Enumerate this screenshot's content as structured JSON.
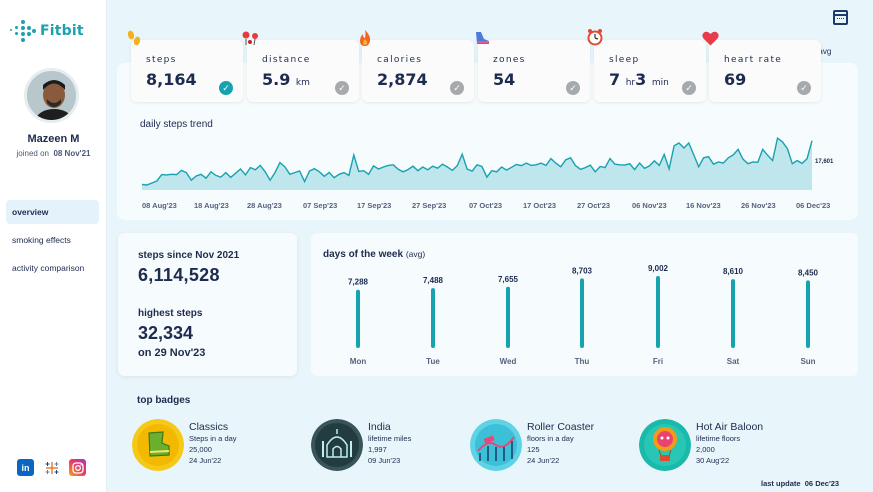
{
  "brand": {
    "name": "Fitbit",
    "accent": "#17a2b0"
  },
  "profile": {
    "name": "Mazeen M",
    "joined_label": "joined on",
    "joined_date": "08 Nov'21"
  },
  "nav": [
    {
      "label": "overview",
      "active": true
    },
    {
      "label": "smoking effects",
      "active": false
    },
    {
      "label": "activity comparison",
      "active": false
    }
  ],
  "socials": [
    "linkedin-icon",
    "tableau-icon",
    "instagram-icon"
  ],
  "avg_legend": "◀ avg",
  "stats": [
    {
      "label": "steps",
      "value": "8,164",
      "unit": "",
      "extra": "",
      "extra_unit": "",
      "icon": "footsteps-icon",
      "above_avg": true
    },
    {
      "label": "distance",
      "value": "5.9",
      "unit": "km",
      "extra": "",
      "extra_unit": "",
      "icon": "pin-icon",
      "above_avg": false
    },
    {
      "label": "calories",
      "value": "2,874",
      "unit": "",
      "extra": "",
      "extra_unit": "",
      "icon": "flame-icon",
      "above_avg": false
    },
    {
      "label": "zones",
      "value": "54",
      "unit": "",
      "extra": "",
      "extra_unit": "",
      "icon": "shoe-icon",
      "above_avg": false
    },
    {
      "label": "sleep",
      "value": "7",
      "unit": "hr",
      "extra": "3",
      "extra_unit": "min",
      "icon": "alarm-clock-icon",
      "above_avg": false
    },
    {
      "label": "heart rate",
      "value": "69",
      "unit": "",
      "extra": "",
      "extra_unit": "",
      "icon": "heart-icon",
      "above_avg": false
    }
  ],
  "trend": {
    "title": "daily steps trend",
    "last_value_label": "17,601",
    "x_ticks": [
      "08 Aug'23",
      "18 Aug'23",
      "28 Aug'23",
      "07 Sep'23",
      "17 Sep'23",
      "27 Sep'23",
      "07 Oct'23",
      "17 Oct'23",
      "27 Oct'23",
      "06 Nov'23",
      "16 Nov'23",
      "26 Nov'23",
      "06 Dec'23"
    ]
  },
  "chart_data": [
    {
      "type": "area",
      "title": "daily steps trend",
      "x_start": "08 Aug'23",
      "x_end": "06 Dec'23",
      "x_ticks": [
        "08 Aug'23",
        "18 Aug'23",
        "28 Aug'23",
        "07 Sep'23",
        "17 Sep'23",
        "27 Sep'23",
        "07 Oct'23",
        "17 Oct'23",
        "27 Oct'23",
        "06 Nov'23",
        "16 Nov'23",
        "26 Nov'23",
        "06 Dec'23"
      ],
      "values": [
        2000,
        1800,
        2500,
        3200,
        5500,
        5400,
        5600,
        5500,
        7000,
        6200,
        3500,
        5000,
        5600,
        4200,
        6500,
        5200,
        4600,
        6200,
        4500,
        6000,
        7500,
        5400,
        8000,
        7200,
        8800,
        6500,
        3500,
        6200,
        9800,
        8300,
        5600,
        6200,
        6800,
        3000,
        6800,
        7600,
        6500,
        4900,
        6300,
        4400,
        5600,
        6200,
        5200,
        12500,
        6600,
        6900,
        5600,
        8600,
        7500,
        8200,
        8800,
        9000,
        7400,
        6500,
        7300,
        8500,
        6900,
        8200,
        7200,
        8500,
        7800,
        9200,
        8200,
        7000,
        8700,
        12800,
        7500,
        6700,
        9000,
        8400,
        4600,
        6900,
        6500,
        8200,
        7100,
        8100,
        9100,
        8700,
        9600,
        8800,
        9000,
        9600,
        8800,
        11200,
        9600,
        8300,
        10800,
        11500,
        8700,
        7400,
        8000,
        8900,
        6500,
        8400,
        8000,
        11200,
        9200,
        9000,
        8900,
        9400,
        7300,
        9600,
        7700,
        8600,
        10400,
        8800,
        12700,
        7500,
        15800,
        16800,
        15000,
        16800,
        12500,
        8300,
        11500,
        11900,
        9200,
        10000,
        9600,
        11500,
        12500,
        14500,
        11000,
        9400,
        10000,
        9900,
        14500,
        12400,
        10500,
        18500,
        17200,
        14800,
        9400,
        10500,
        9500,
        11200,
        17601
      ],
      "ylim": [
        0,
        20000
      ]
    },
    {
      "type": "bar",
      "title": "days of the week (avg)",
      "categories": [
        "Mon",
        "Tue",
        "Wed",
        "Thu",
        "Fri",
        "Sat",
        "Sun"
      ],
      "values": [
        7288,
        7488,
        7655,
        8703,
        9002,
        8610,
        8450
      ],
      "labels": [
        "7,288",
        "7,488",
        "7,655",
        "8,703",
        "9,002",
        "8,610",
        "8,450"
      ],
      "ylim": [
        0,
        10000
      ]
    }
  ],
  "summary": {
    "since_label": "steps since Nov 2021",
    "since_value": "6,114,528",
    "highest_label": "highest steps",
    "highest_value": "32,334",
    "highest_date": "on 29 Nov'23"
  },
  "dow": {
    "title": "days of the week",
    "title_suffix": "(avg)"
  },
  "badges_title": "top badges",
  "badges": [
    {
      "name": "Classics",
      "desc": "Steps in a day",
      "value": "25,000",
      "date": "24 Jun'22",
      "icon": "classics-badge-icon",
      "color": "#f3c712"
    },
    {
      "name": "India",
      "desc": "lifetime miles",
      "value": "1,997",
      "date": "09 Jun'23",
      "icon": "india-badge-icon",
      "color": "#2e4a4a"
    },
    {
      "name": "Roller Coaster",
      "desc": "floors in a day",
      "value": "125",
      "date": "24 Jun'22",
      "icon": "roller-coaster-badge-icon",
      "color": "#37c4dc"
    },
    {
      "name": "Hot Air Baloon",
      "desc": "lifetime floors",
      "value": "2,000",
      "date": "30 Aug'22",
      "icon": "hot-air-balloon-badge-icon",
      "color": "#19b8a8"
    }
  ],
  "last_update_label": "last update",
  "last_update_date": "06 Dec'23"
}
